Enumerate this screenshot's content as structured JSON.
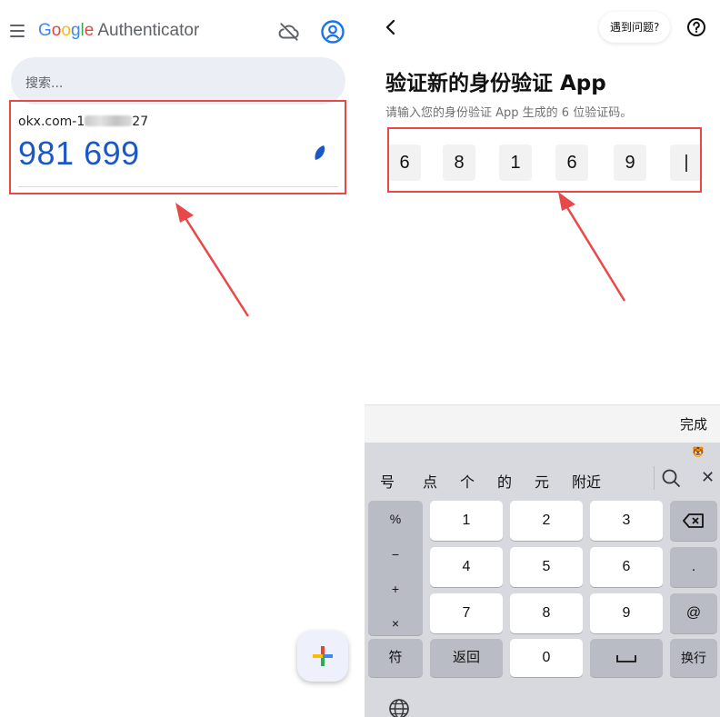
{
  "left": {
    "app_title_google": [
      "G",
      "o",
      "o",
      "g",
      "l",
      "e"
    ],
    "app_title_suffix": "Authenticator",
    "search_placeholder": "搜索...",
    "account": {
      "issuer_prefix": "okx.com-1",
      "issuer_suffix": "27",
      "code": "981 699"
    }
  },
  "right": {
    "help_label": "遇到问题?",
    "title": "验证新的身份验证 App",
    "subtitle": "请输入您的身份验证 App 生成的 6 位验证码。",
    "digits": [
      "6",
      "8",
      "1",
      "6",
      "9",
      "|"
    ],
    "done_label": "完成",
    "keyboard": {
      "suggestions": [
        "号",
        "点",
        "个",
        "的",
        "元",
        "附近"
      ],
      "symbols": [
        "%",
        "−",
        "+",
        "×"
      ],
      "rows": [
        [
          "1",
          "2",
          "3"
        ],
        [
          "4",
          "5",
          "6"
        ],
        [
          "7",
          "8",
          "9"
        ]
      ],
      "zero": "0",
      "dot": ".",
      "at": "@",
      "fu_label": "符",
      "back_label": "返回",
      "enter_label": "换行"
    }
  },
  "colors": {
    "annotation_red": "#e94848",
    "code_blue": "#1a57c9"
  }
}
